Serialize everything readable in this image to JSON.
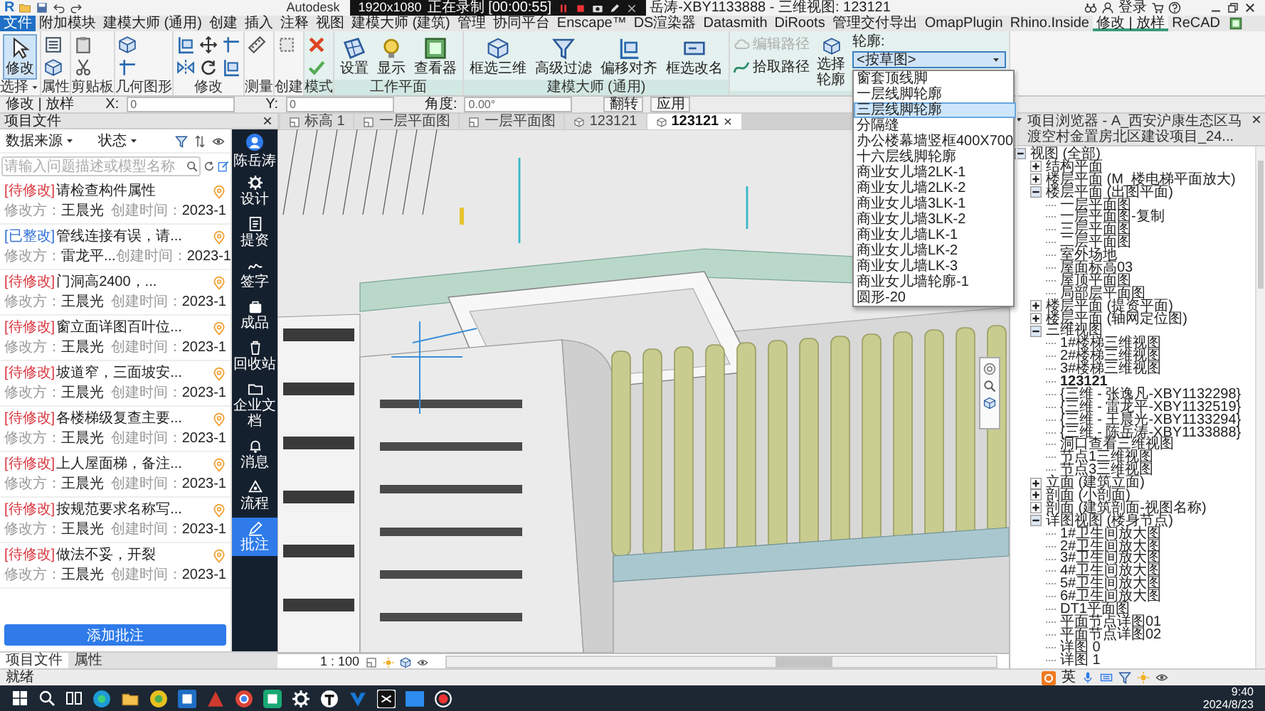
{
  "title_bar": {
    "logo": "R",
    "app_name": "Autodesk",
    "recorder": {
      "resolution": "1920x1080",
      "status": "正在录制 [00:00:55]"
    },
    "title": "岳涛-XBY1133888 - 三维视图: 123121",
    "sign_in": "登录"
  },
  "ribbon": {
    "tabs": [
      {
        "label": "文件",
        "kind": "file",
        "selected": false
      },
      {
        "label": "附加模块",
        "kind": "tab",
        "selected": false
      },
      {
        "label": "建模大师 (通用)",
        "kind": "tab",
        "selected": false
      },
      {
        "label": "创建",
        "kind": "tab",
        "selected": false
      },
      {
        "label": "插入",
        "kind": "tab",
        "selected": false
      },
      {
        "label": "注释",
        "kind": "tab",
        "selected": false
      },
      {
        "label": "视图",
        "kind": "tab",
        "selected": false
      },
      {
        "label": "建模大师 (建筑)",
        "kind": "tab",
        "selected": false
      },
      {
        "label": "管理",
        "kind": "tab",
        "selected": false
      },
      {
        "label": "协同平台",
        "kind": "tab",
        "selected": false
      },
      {
        "label": "Enscape™",
        "kind": "tab",
        "selected": false
      },
      {
        "label": "DS渲染器",
        "kind": "tab",
        "selected": false
      },
      {
        "label": "Datasmith",
        "kind": "tab",
        "selected": false
      },
      {
        "label": "DiRoots",
        "kind": "tab",
        "selected": false
      },
      {
        "label": "管理交付导出",
        "kind": "tab",
        "selected": false
      },
      {
        "label": "OmapPlugin",
        "kind": "tab",
        "selected": false
      },
      {
        "label": "Rhino.Inside",
        "kind": "tab",
        "selected": false
      },
      {
        "label": "修改 | 放样",
        "kind": "context",
        "selected": true
      },
      {
        "label": "ReCAD",
        "kind": "tab",
        "selected": false
      }
    ],
    "panels": [
      {
        "label": "选择",
        "contextual": false,
        "tools": [
          {
            "label": "修改",
            "active": true
          }
        ]
      },
      {
        "label": "属性",
        "contextual": false
      },
      {
        "label": "剪贴板",
        "contextual": false
      },
      {
        "label": "几何图形",
        "contextual": false
      },
      {
        "label": "修改",
        "contextual": false
      },
      {
        "label": "测量",
        "contextual": false
      },
      {
        "label": "创建",
        "contextual": false
      },
      {
        "label": "模式",
        "contextual": true
      },
      {
        "label": "工作平面",
        "contextual": true,
        "tools": [
          {
            "label": "设置"
          },
          {
            "label": "显示"
          },
          {
            "label": "查看器"
          }
        ]
      },
      {
        "label": "建模大师 (通用)",
        "contextual": true,
        "tools": [
          {
            "label": "框选三维"
          },
          {
            "label": "高级过滤"
          },
          {
            "label": "偏移对齐"
          },
          {
            "label": "框选改名"
          }
        ]
      },
      {
        "contextual": true,
        "tools": [
          {
            "label": "编辑路径",
            "disabled": true
          },
          {
            "label": "拾取路径",
            "disabled": false
          },
          {
            "label": "选择轮廓",
            "disabled": false
          }
        ],
        "profile": {
          "label": "轮廓:",
          "value": "<按草图>",
          "options": [
            {
              "label": "窗套顶线脚",
              "selected": false
            },
            {
              "label": "一层线脚轮廓",
              "selected": false
            },
            {
              "label": "三层线脚轮廓",
              "selected": true
            },
            {
              "label": "分隔缝",
              "selected": false
            },
            {
              "label": "办公楼幕墙竖框400X700",
              "selected": false
            },
            {
              "label": "十六层线脚轮廓",
              "selected": false
            },
            {
              "label": "商业女儿墙2LK-1",
              "selected": false
            },
            {
              "label": "商业女儿墙2LK-2",
              "selected": false
            },
            {
              "label": "商业女儿墙3LK-1",
              "selected": false
            },
            {
              "label": "商业女儿墙3LK-2",
              "selected": false
            },
            {
              "label": "商业女儿墙LK-1",
              "selected": false
            },
            {
              "label": "商业女儿墙LK-2",
              "selected": false
            },
            {
              "label": "商业女儿墙LK-3",
              "selected": false
            },
            {
              "label": "商业女儿墙轮廓-1",
              "selected": false
            },
            {
              "label": "圆形-20",
              "selected": false
            }
          ]
        }
      }
    ]
  },
  "options_bar": {
    "context": "修改 | 放样",
    "fields": [
      {
        "label": "X:",
        "value": "0"
      },
      {
        "label": "Y:",
        "value": "0"
      },
      {
        "label": "角度:",
        "value": "0.00°"
      }
    ],
    "buttons": [
      "翻转",
      "应用"
    ]
  },
  "left_panel": {
    "title": "项目文件",
    "filters": [
      "数据来源",
      "状态"
    ],
    "search": {
      "placeholder": "请输入问题描述或模型名称"
    },
    "issues": [
      {
        "status": "[待修改]",
        "kind": "pending",
        "title": "请检查构件属性",
        "assignee_label": "修改方：",
        "assignee": "王晨光",
        "created_label": "创建时间：",
        "created": "2023-1"
      },
      {
        "status": "[已整改]",
        "kind": "done",
        "title": "管线连接有误，请...",
        "assignee_label": "修改方：",
        "assignee": "雷龙平...",
        "created_label": "创建时间：",
        "created": "2023-1"
      },
      {
        "status": "[待修改]",
        "kind": "pending",
        "title": "门洞高2400，...",
        "assignee_label": "修改方：",
        "assignee": "王晨光",
        "created_label": "创建时间：",
        "created": "2023-1"
      },
      {
        "status": "[待修改]",
        "kind": "pending",
        "title": "窗立面详图百叶位...",
        "assignee_label": "修改方：",
        "assignee": "王晨光",
        "created_label": "创建时间：",
        "created": "2023-1"
      },
      {
        "status": "[待修改]",
        "kind": "pending",
        "title": "坡道窄，三面坡安...",
        "assignee_label": "修改方：",
        "assignee": "王晨光",
        "created_label": "创建时间：",
        "created": "2023-1"
      },
      {
        "status": "[待修改]",
        "kind": "pending",
        "title": "各楼梯级复查主要...",
        "assignee_label": "修改方：",
        "assignee": "王晨光",
        "created_label": "创建时间：",
        "created": "2023-1"
      },
      {
        "status": "[待修改]",
        "kind": "pending",
        "title": "上人屋面梯，备注...",
        "assignee_label": "修改方：",
        "assignee": "王晨光",
        "created_label": "创建时间：",
        "created": "2023-1"
      },
      {
        "status": "[待修改]",
        "kind": "pending",
        "title": "按规范要求名称写...",
        "assignee_label": "修改方：",
        "assignee": "王晨光",
        "created_label": "创建时间：",
        "created": "2023-1"
      },
      {
        "status": "[待修改]",
        "kind": "pending",
        "title": "做法不妥，开裂",
        "assignee_label": "修改方：",
        "assignee": "王晨光",
        "created_label": "创建时间：",
        "created": "2023-1"
      }
    ],
    "add_button": "添加批注",
    "sidebar": {
      "user": "陈岳涛",
      "items": [
        {
          "label": "设计",
          "selected": false
        },
        {
          "label": "提资",
          "selected": false
        },
        {
          "label": "签字",
          "selected": false
        },
        {
          "label": "成品",
          "selected": false
        },
        {
          "label": "回收站",
          "selected": false
        },
        {
          "label": "企业文档",
          "selected": false
        },
        {
          "label": "消息",
          "selected": false
        },
        {
          "label": "流程",
          "selected": false
        },
        {
          "label": "批注",
          "selected": true
        }
      ]
    },
    "bottom_tabs": [
      {
        "label": "项目文件",
        "selected": true
      },
      {
        "label": "属性",
        "selected": false
      }
    ]
  },
  "view_tabs": [
    {
      "label": "标高 1",
      "kind": "plan",
      "selected": false
    },
    {
      "label": "一层平面图",
      "kind": "plan",
      "selected": false
    },
    {
      "label": "一层平面图",
      "kind": "plan",
      "selected": false
    },
    {
      "label": "123121",
      "kind": "model",
      "selected": false
    },
    {
      "label": "123121",
      "kind": "model",
      "selected": true
    }
  ],
  "viewport": {
    "scale": "1 : 100"
  },
  "browser": {
    "title": "项目浏览器 - A_西安沪康生态区马渡空村金置房北区建设项目_24...",
    "tree": [
      {
        "label": "视图 (全部)",
        "selected": false,
        "expanded": true,
        "children": [
          {
            "label": "结构平面",
            "selected": false,
            "expanded": false
          },
          {
            "label": "楼层平面 (M_楼电梯平面放大)",
            "selected": false,
            "expanded": false
          },
          {
            "label": "楼层平面 (出图平面)",
            "selected": false,
            "expanded": true,
            "children": [
              {
                "label": "一层平面图",
                "selected": false
              },
              {
                "label": "一层平面图-复制",
                "selected": false
              },
              {
                "label": "三层平面图",
                "selected": false
              },
              {
                "label": "二层平面图",
                "selected": false
              },
              {
                "label": "室外场地",
                "selected": false
              },
              {
                "label": "屋面标高03",
                "selected": false
              },
              {
                "label": "屋顶平面图",
                "selected": false
              },
              {
                "label": "局部层平面图",
                "selected": false
              }
            ]
          },
          {
            "label": "楼层平面 (提资平面)",
            "selected": false,
            "expanded": false
          },
          {
            "label": "楼层平面 (轴网定位图)",
            "selected": false,
            "expanded": false
          },
          {
            "label": "三维视图",
            "selected": false,
            "expanded": true,
            "children": [
              {
                "label": "1#楼梯三维视图",
                "selected": false
              },
              {
                "label": "2#楼梯三维视图",
                "selected": false
              },
              {
                "label": "3#楼梯三维视图",
                "selected": false
              },
              {
                "label": "123121",
                "selected": true
              },
              {
                "label": "{三维 - 张逸凡-XBY1132298}",
                "selected": false
              },
              {
                "label": "{三维 - 雷龙平-XBY1132519}",
                "selected": false
              },
              {
                "label": "{三维 - 王晨光-XBY1133294}",
                "selected": false
              },
              {
                "label": "{三维 - 陈岳涛-XBY1133888}",
                "selected": false
              },
              {
                "label": "洞口查看三维视图",
                "selected": false
              },
              {
                "label": "节点1三维视图",
                "selected": false
              },
              {
                "label": "节点3三维视图",
                "selected": false
              }
            ]
          },
          {
            "label": "立面 (建筑立面)",
            "selected": false,
            "expanded": false
          },
          {
            "label": "剖面 (小剖面)",
            "selected": false,
            "expanded": false
          },
          {
            "label": "剖面 (建筑剖面-视图名称)",
            "selected": false,
            "expanded": false
          },
          {
            "label": "详图视图 (楼身节点)",
            "selected": false,
            "expanded": true,
            "children": [
              {
                "label": "1#卫生间放大图",
                "selected": false
              },
              {
                "label": "2#卫生间放大图",
                "selected": false
              },
              {
                "label": "3#卫生间放大图",
                "selected": false
              },
              {
                "label": "4#卫生间放大图",
                "selected": false
              },
              {
                "label": "5#卫生间放大图",
                "selected": false
              },
              {
                "label": "6#卫生间放大图",
                "selected": false
              },
              {
                "label": "DT1平面图",
                "selected": false
              },
              {
                "label": "平面节点详图01",
                "selected": false
              },
              {
                "label": "平面节点详图02",
                "selected": false
              },
              {
                "label": "详图 0",
                "selected": false
              },
              {
                "label": "详图 1",
                "selected": false
              }
            ]
          }
        ]
      }
    ]
  },
  "status_bar": {
    "text": "就绪",
    "ime": "英"
  },
  "taskbar": {
    "time": "9:40",
    "date": "2024/8/23"
  }
}
